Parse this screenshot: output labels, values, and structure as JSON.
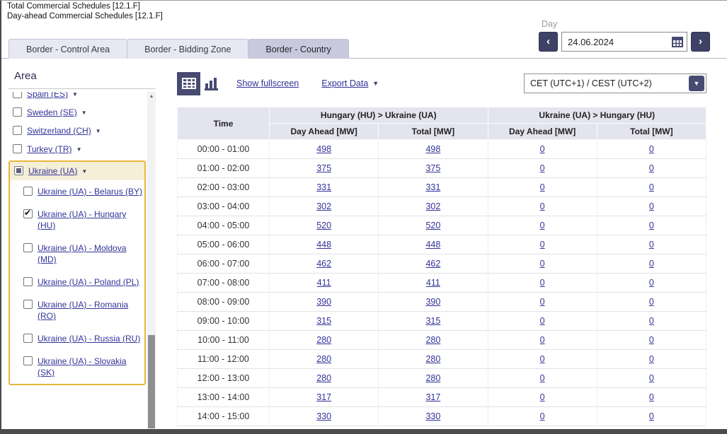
{
  "page": {
    "title_line1": "Total Commercial Schedules [12.1.F]",
    "title_line2": "Day-ahead Commercial Schedules [12.1.F]"
  },
  "date_nav": {
    "label": "Day",
    "date_value": "24.06.2024",
    "prev_symbol": "‹",
    "next_symbol": "›"
  },
  "tabs": [
    {
      "label": "Border - Control Area",
      "active": false
    },
    {
      "label": "Border - Bidding Zone",
      "active": false
    },
    {
      "label": "Border - Country",
      "active": true
    }
  ],
  "sidebar": {
    "heading": "Area",
    "scroll_up_symbol": "▲",
    "items": [
      {
        "label": "Spain (ES)",
        "level": 0,
        "state": "unchecked",
        "arrow": true,
        "in_group": false,
        "clipped": true
      },
      {
        "label": "Sweden (SE)",
        "level": 0,
        "state": "unchecked",
        "arrow": true,
        "in_group": false
      },
      {
        "label": "Switzerland (CH)",
        "level": 0,
        "state": "unchecked",
        "arrow": true,
        "in_group": false
      },
      {
        "label": "Turkey (TR)",
        "level": 0,
        "state": "unchecked",
        "arrow": true,
        "in_group": false
      },
      {
        "label": "Ukraine (UA)",
        "level": 0,
        "state": "partial",
        "arrow": true,
        "in_group": true
      },
      {
        "label": "Ukraine (UA) - Belarus (BY)",
        "level": 1,
        "state": "unchecked",
        "arrow": false,
        "in_group": true
      },
      {
        "label": "Ukraine (UA) - Hungary (HU)",
        "level": 1,
        "state": "checked",
        "arrow": false,
        "in_group": true
      },
      {
        "label": "Ukraine (UA) - Moldova (MD)",
        "level": 1,
        "state": "unchecked",
        "arrow": false,
        "in_group": true
      },
      {
        "label": "Ukraine (UA) - Poland (PL)",
        "level": 1,
        "state": "unchecked",
        "arrow": false,
        "in_group": true
      },
      {
        "label": "Ukraine (UA) - Romania (RO)",
        "level": 1,
        "state": "unchecked",
        "arrow": false,
        "in_group": true
      },
      {
        "label": "Ukraine (UA) - Russia (RU)",
        "level": 1,
        "state": "unchecked",
        "arrow": false,
        "in_group": true
      },
      {
        "label": "Ukraine (UA) - Slovakia (SK)",
        "level": 1,
        "state": "unchecked",
        "arrow": false,
        "in_group": true
      }
    ]
  },
  "toolbar": {
    "show_fullscreen_label": "Show fullscreen",
    "export_data_label": "Export Data",
    "export_arrow": "▼",
    "timezone_value": "CET (UTC+1) / CEST (UTC+2)",
    "timezone_arrow": "▼"
  },
  "chart_data": {
    "type": "table",
    "time_header": "Time",
    "column_groups": [
      {
        "label": "Hungary (HU) > Ukraine (UA)",
        "subcolumns": [
          "Day Ahead [MW]",
          "Total [MW]"
        ]
      },
      {
        "label": "Ukraine (UA) > Hungary (HU)",
        "subcolumns": [
          "Day Ahead [MW]",
          "Total [MW]"
        ]
      }
    ],
    "rows": [
      {
        "time": "00:00 - 01:00",
        "values": [
          "498",
          "498",
          "0",
          "0"
        ]
      },
      {
        "time": "01:00 - 02:00",
        "values": [
          "375",
          "375",
          "0",
          "0"
        ]
      },
      {
        "time": "02:00 - 03:00",
        "values": [
          "331",
          "331",
          "0",
          "0"
        ]
      },
      {
        "time": "03:00 - 04:00",
        "values": [
          "302",
          "302",
          "0",
          "0"
        ]
      },
      {
        "time": "04:00 - 05:00",
        "values": [
          "520",
          "520",
          "0",
          "0"
        ]
      },
      {
        "time": "05:00 - 06:00",
        "values": [
          "448",
          "448",
          "0",
          "0"
        ]
      },
      {
        "time": "06:00 - 07:00",
        "values": [
          "462",
          "462",
          "0",
          "0"
        ]
      },
      {
        "time": "07:00 - 08:00",
        "values": [
          "411",
          "411",
          "0",
          "0"
        ]
      },
      {
        "time": "08:00 - 09:00",
        "values": [
          "390",
          "390",
          "0",
          "0"
        ]
      },
      {
        "time": "09:00 - 10:00",
        "values": [
          "315",
          "315",
          "0",
          "0"
        ]
      },
      {
        "time": "10:00 - 11:00",
        "values": [
          "280",
          "280",
          "0",
          "0"
        ]
      },
      {
        "time": "11:00 - 12:00",
        "values": [
          "280",
          "280",
          "0",
          "0"
        ]
      },
      {
        "time": "12:00 - 13:00",
        "values": [
          "280",
          "280",
          "0",
          "0"
        ]
      },
      {
        "time": "13:00 - 14:00",
        "values": [
          "317",
          "317",
          "0",
          "0"
        ]
      },
      {
        "time": "14:00 - 15:00",
        "values": [
          "330",
          "330",
          "0",
          "0"
        ]
      }
    ]
  },
  "colors": {
    "accent_navy": "#474b72",
    "nav_button_navy": "#3d4266",
    "link": "#333399",
    "highlight_border": "#e8b83e",
    "highlight_bg": "#f6efd8",
    "table_header_bg": "#e4e4ef"
  }
}
